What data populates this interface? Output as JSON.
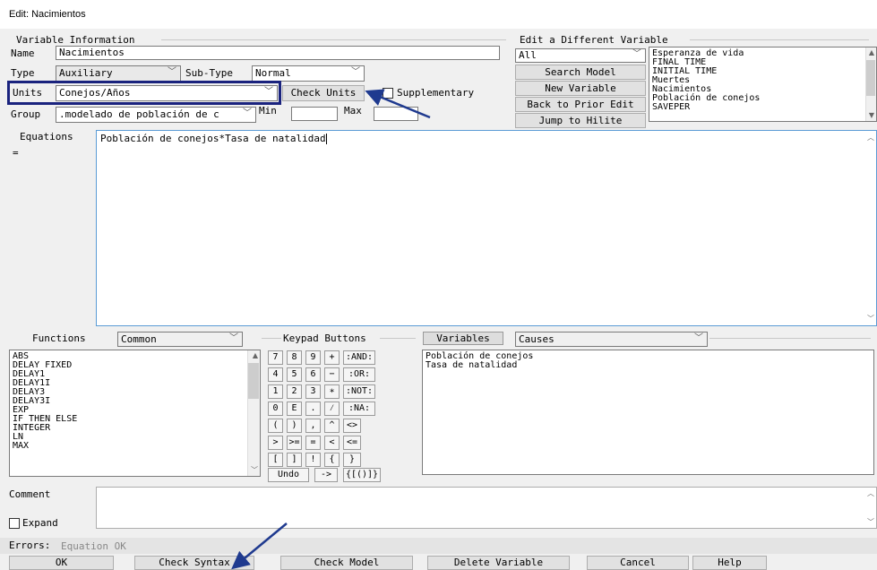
{
  "window": {
    "title": "Edit: Nacimientos"
  },
  "var_info": {
    "heading": "Variable Information",
    "name_label": "Name",
    "name_value": "Nacimientos",
    "type_label": "Type",
    "type_value": "Auxiliary",
    "subtype_label": "Sub-Type",
    "subtype_value": "Normal",
    "units_label": "Units",
    "units_value": "Conejos/Años",
    "check_units_label": "Check Units",
    "supplementary_label": "Supplementary",
    "group_label": "Group",
    "group_value": ".modelado de población de c",
    "min_label": "Min",
    "min_value": "",
    "max_label": "Max",
    "max_value": ""
  },
  "edit_different": {
    "heading": "Edit a Different Variable",
    "filter_value": "All",
    "search_label": "Search Model",
    "new_label": "New Variable",
    "back_label": "Back to Prior Edit",
    "jump_label": "Jump to Hilite",
    "variables": [
      "Esperanza de vida",
      "FINAL TIME",
      "INITIAL TIME",
      "Muertes",
      "Nacimientos",
      "Población de conejos",
      "SAVEPER"
    ]
  },
  "equations": {
    "label": "Equations",
    "eq_sign": "=",
    "text": "Población de conejos*Tasa de natalidad"
  },
  "functions": {
    "label": "Functions",
    "category": "Common",
    "items": [
      "ABS",
      "DELAY FIXED",
      "DELAY1",
      "DELAY1I",
      "DELAY3",
      "DELAY3I",
      "EXP",
      "IF THEN ELSE",
      "INTEGER",
      "LN",
      "MAX"
    ]
  },
  "keypad": {
    "label": "Keypad Buttons",
    "rows": [
      [
        "7",
        "8",
        "9",
        "+",
        ":AND:"
      ],
      [
        "4",
        "5",
        "6",
        "−",
        ":OR:"
      ],
      [
        "1",
        "2",
        "3",
        "∗",
        ":NOT:"
      ],
      [
        "0",
        "E",
        ".",
        "⁄",
        ":NA:"
      ],
      [
        "(",
        ")",
        ",",
        "^",
        "<>"
      ],
      [
        ">",
        ">=",
        "=",
        "<",
        "<="
      ],
      [
        "[",
        "]",
        "!",
        "{",
        "}"
      ]
    ],
    "undo_label": "Undo",
    "arrow_label": "->",
    "brackets_label": "{[()]}"
  },
  "variables_panel": {
    "tab_label": "Variables",
    "mode_value": "Causes",
    "items": [
      "Población de conejos",
      "Tasa de natalidad"
    ]
  },
  "comment": {
    "label": "Comment",
    "value": ""
  },
  "expand": {
    "label": "Expand"
  },
  "errors": {
    "label": "Errors:",
    "value": "Equation OK"
  },
  "footer": {
    "ok_label": "OK",
    "check_syntax_label": "Check Syntax",
    "check_model_label": "Check Model",
    "delete_label": "Delete Variable",
    "cancel_label": "Cancel",
    "help_label": "Help"
  },
  "colors": {
    "highlight_frame": "#1a237e",
    "arrow": "#1f3a8f",
    "focus_border": "#5b9bd5"
  }
}
